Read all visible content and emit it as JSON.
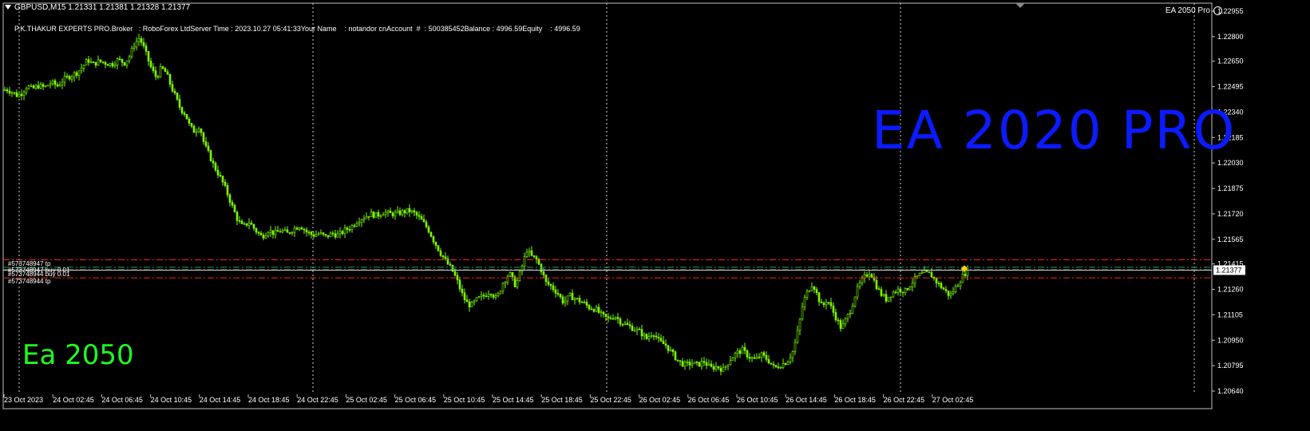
{
  "header": {
    "symbol_line": "GBPUSD,M15  1.21331 1.21381 1.21328 1.21377",
    "info_line": "P.K.THAKUR EXPERTS PRO.Broker   : RoboForex LtdServer Time : 2023.10.27 05:41:33Your Name    : notandor cnAccount  #  : 500385452Balance : 4996.59Equity    : 4996.59",
    "ea_name": "EA 2050 Pro"
  },
  "overlay": {
    "blue_text": "EA 2020 PRO",
    "green_text": "Ea 2050"
  },
  "orders": [
    {
      "label": "#573748947 tp",
      "kind": "tp"
    },
    {
      "label": "#573748947 buy 0.01",
      "kind": "entry"
    },
    {
      "label": "#573748944 buy 0.01",
      "kind": "entry"
    },
    {
      "label": "#573748944 tp",
      "kind": "tp"
    }
  ],
  "current_price_label": "1.21377",
  "colors": {
    "background": "#000000",
    "candle": "#7cfc00",
    "grid": "#c0c0c0",
    "tp_line": "#ff2020",
    "entry_line": "#2e8b57",
    "blue_text": "#0a1bff",
    "green_text": "#1fff1f"
  },
  "chart_data": {
    "type": "candlestick",
    "symbol": "GBPUSD",
    "timeframe": "M15",
    "ylim": [
      1.2064,
      1.22955
    ],
    "y_ticks": [
      "1.22955",
      "1.22800",
      "1.22650",
      "1.22495",
      "1.22340",
      "1.22185",
      "1.22030",
      "1.21875",
      "1.21720",
      "1.21565",
      "1.21415",
      "1.21260",
      "1.21105",
      "1.20950",
      "1.20795",
      "1.20640"
    ],
    "x_ticks": [
      "23 Oct 2023",
      "24 Oct 02:45",
      "24 Oct 06:45",
      "24 Oct 10:45",
      "24 Oct 14:45",
      "24 Oct 18:45",
      "24 Oct 22:45",
      "25 Oct 02:45",
      "25 Oct 06:45",
      "25 Oct 10:45",
      "25 Oct 14:45",
      "25 Oct 18:45",
      "25 Oct 22:45",
      "26 Oct 02:45",
      "26 Oct 06:45",
      "26 Oct 10:45",
      "26 Oct 14:45",
      "26 Oct 18:45",
      "26 Oct 22:45",
      "27 Oct 02:45"
    ],
    "price_path": [
      [
        0,
        1.2247
      ],
      [
        8,
        1.2248
      ],
      [
        16,
        1.2246
      ],
      [
        22,
        1.2244
      ],
      [
        28,
        1.2246
      ],
      [
        34,
        1.225
      ],
      [
        40,
        1.2248
      ],
      [
        48,
        1.225
      ],
      [
        56,
        1.2249
      ],
      [
        64,
        1.2252
      ],
      [
        72,
        1.225
      ],
      [
        80,
        1.2254
      ],
      [
        88,
        1.2256
      ],
      [
        96,
        1.2258
      ],
      [
        104,
        1.2262
      ],
      [
        110,
        1.2266
      ],
      [
        116,
        1.2263
      ],
      [
        124,
        1.2265
      ],
      [
        132,
        1.2264
      ],
      [
        140,
        1.2263
      ],
      [
        148,
        1.2266
      ],
      [
        156,
        1.2264
      ],
      [
        162,
        1.2268
      ],
      [
        168,
        1.2275
      ],
      [
        174,
        1.2279
      ],
      [
        178,
        1.2276
      ],
      [
        184,
        1.2268
      ],
      [
        190,
        1.226
      ],
      [
        196,
        1.2255
      ],
      [
        202,
        1.2261
      ],
      [
        208,
        1.2258
      ],
      [
        214,
        1.225
      ],
      [
        220,
        1.2243
      ],
      [
        226,
        1.2236
      ],
      [
        232,
        1.2233
      ],
      [
        238,
        1.2225
      ],
      [
        244,
        1.2222
      ],
      [
        250,
        1.2226
      ],
      [
        256,
        1.2214
      ],
      [
        262,
        1.2208
      ],
      [
        268,
        1.2201
      ],
      [
        274,
        1.2196
      ],
      [
        280,
        1.219
      ],
      [
        286,
        1.2183
      ],
      [
        292,
        1.2175
      ],
      [
        298,
        1.2168
      ],
      [
        304,
        1.2164
      ],
      [
        312,
        1.2167
      ],
      [
        320,
        1.2162
      ],
      [
        328,
        1.2158
      ],
      [
        336,
        1.2162
      ],
      [
        344,
        1.216
      ],
      [
        352,
        1.2162
      ],
      [
        360,
        1.216
      ],
      [
        368,
        1.2163
      ],
      [
        376,
        1.2165
      ],
      [
        384,
        1.2161
      ],
      [
        392,
        1.2159
      ],
      [
        400,
        1.216
      ],
      [
        408,
        1.2158
      ],
      [
        416,
        1.216
      ],
      [
        424,
        1.2159
      ],
      [
        432,
        1.2162
      ],
      [
        440,
        1.2164
      ],
      [
        448,
        1.2168
      ],
      [
        456,
        1.217
      ],
      [
        464,
        1.2172
      ],
      [
        472,
        1.2171
      ],
      [
        480,
        1.2173
      ],
      [
        488,
        1.2172
      ],
      [
        496,
        1.2172
      ],
      [
        504,
        1.2173
      ],
      [
        512,
        1.2174
      ],
      [
        520,
        1.2172
      ],
      [
        528,
        1.2168
      ],
      [
        536,
        1.2163
      ],
      [
        544,
        1.2155
      ],
      [
        552,
        1.2148
      ],
      [
        560,
        1.2142
      ],
      [
        566,
        1.2138
      ],
      [
        572,
        1.2132
      ],
      [
        578,
        1.2124
      ],
      [
        584,
        1.2118
      ],
      [
        590,
        1.2116
      ],
      [
        598,
        1.212
      ],
      [
        606,
        1.2122
      ],
      [
        614,
        1.2125
      ],
      [
        622,
        1.212
      ],
      [
        630,
        1.213
      ],
      [
        638,
        1.2136
      ],
      [
        646,
        1.2128
      ],
      [
        654,
        1.214
      ],
      [
        660,
        1.215
      ],
      [
        666,
        1.2146
      ],
      [
        672,
        1.2144
      ],
      [
        678,
        1.2138
      ],
      [
        684,
        1.213
      ],
      [
        690,
        1.2128
      ],
      [
        698,
        1.2124
      ],
      [
        706,
        1.2118
      ],
      [
        714,
        1.2122
      ],
      [
        722,
        1.212
      ],
      [
        730,
        1.2118
      ],
      [
        738,
        1.2115
      ],
      [
        746,
        1.2114
      ],
      [
        754,
        1.211
      ],
      [
        762,
        1.2108
      ],
      [
        770,
        1.211
      ],
      [
        778,
        1.2106
      ],
      [
        786,
        1.2104
      ],
      [
        794,
        1.2102
      ],
      [
        802,
        1.21
      ],
      [
        810,
        1.2096
      ],
      [
        818,
        1.21
      ],
      [
        826,
        1.2094
      ],
      [
        834,
        1.2092
      ],
      [
        842,
        1.2087
      ],
      [
        850,
        1.2082
      ],
      [
        858,
        1.208
      ],
      [
        866,
        1.2081
      ],
      [
        874,
        1.208
      ],
      [
        882,
        1.2082
      ],
      [
        890,
        1.2078
      ],
      [
        898,
        1.2079
      ],
      [
        906,
        1.2077
      ],
      [
        914,
        1.2083
      ],
      [
        922,
        1.2087
      ],
      [
        930,
        1.2089
      ],
      [
        938,
        1.2085
      ],
      [
        946,
        1.2083
      ],
      [
        954,
        1.2086
      ],
      [
        962,
        1.2083
      ],
      [
        970,
        1.2078
      ],
      [
        978,
        1.208
      ],
      [
        986,
        1.2082
      ],
      [
        994,
        1.2089
      ],
      [
        1000,
        1.2102
      ],
      [
        1006,
        1.2118
      ],
      [
        1012,
        1.2125
      ],
      [
        1018,
        1.213
      ],
      [
        1024,
        1.2122
      ],
      [
        1030,
        1.2115
      ],
      [
        1036,
        1.212
      ],
      [
        1042,
        1.2114
      ],
      [
        1048,
        1.2108
      ],
      [
        1054,
        1.2102
      ],
      [
        1060,
        1.2108
      ],
      [
        1066,
        1.2114
      ],
      [
        1072,
        1.2124
      ],
      [
        1078,
        1.213
      ],
      [
        1084,
        1.2134
      ],
      [
        1090,
        1.2137
      ],
      [
        1096,
        1.213
      ],
      [
        1102,
        1.2124
      ],
      [
        1110,
        1.212
      ],
      [
        1118,
        1.2124
      ],
      [
        1126,
        1.2126
      ],
      [
        1134,
        1.2125
      ],
      [
        1142,
        1.213
      ],
      [
        1150,
        1.2134
      ],
      [
        1158,
        1.2136
      ],
      [
        1166,
        1.2135
      ],
      [
        1174,
        1.213
      ],
      [
        1182,
        1.2126
      ],
      [
        1190,
        1.2122
      ],
      [
        1198,
        1.2128
      ],
      [
        1206,
        1.2134
      ],
      [
        1212,
        1.2138
      ]
    ],
    "orders_price": {
      "tp_upper": 1.2144,
      "entry_1": 1.21395,
      "entry_2": 1.2138,
      "tp_lower": 1.2133
    },
    "current_price": 1.21377
  }
}
